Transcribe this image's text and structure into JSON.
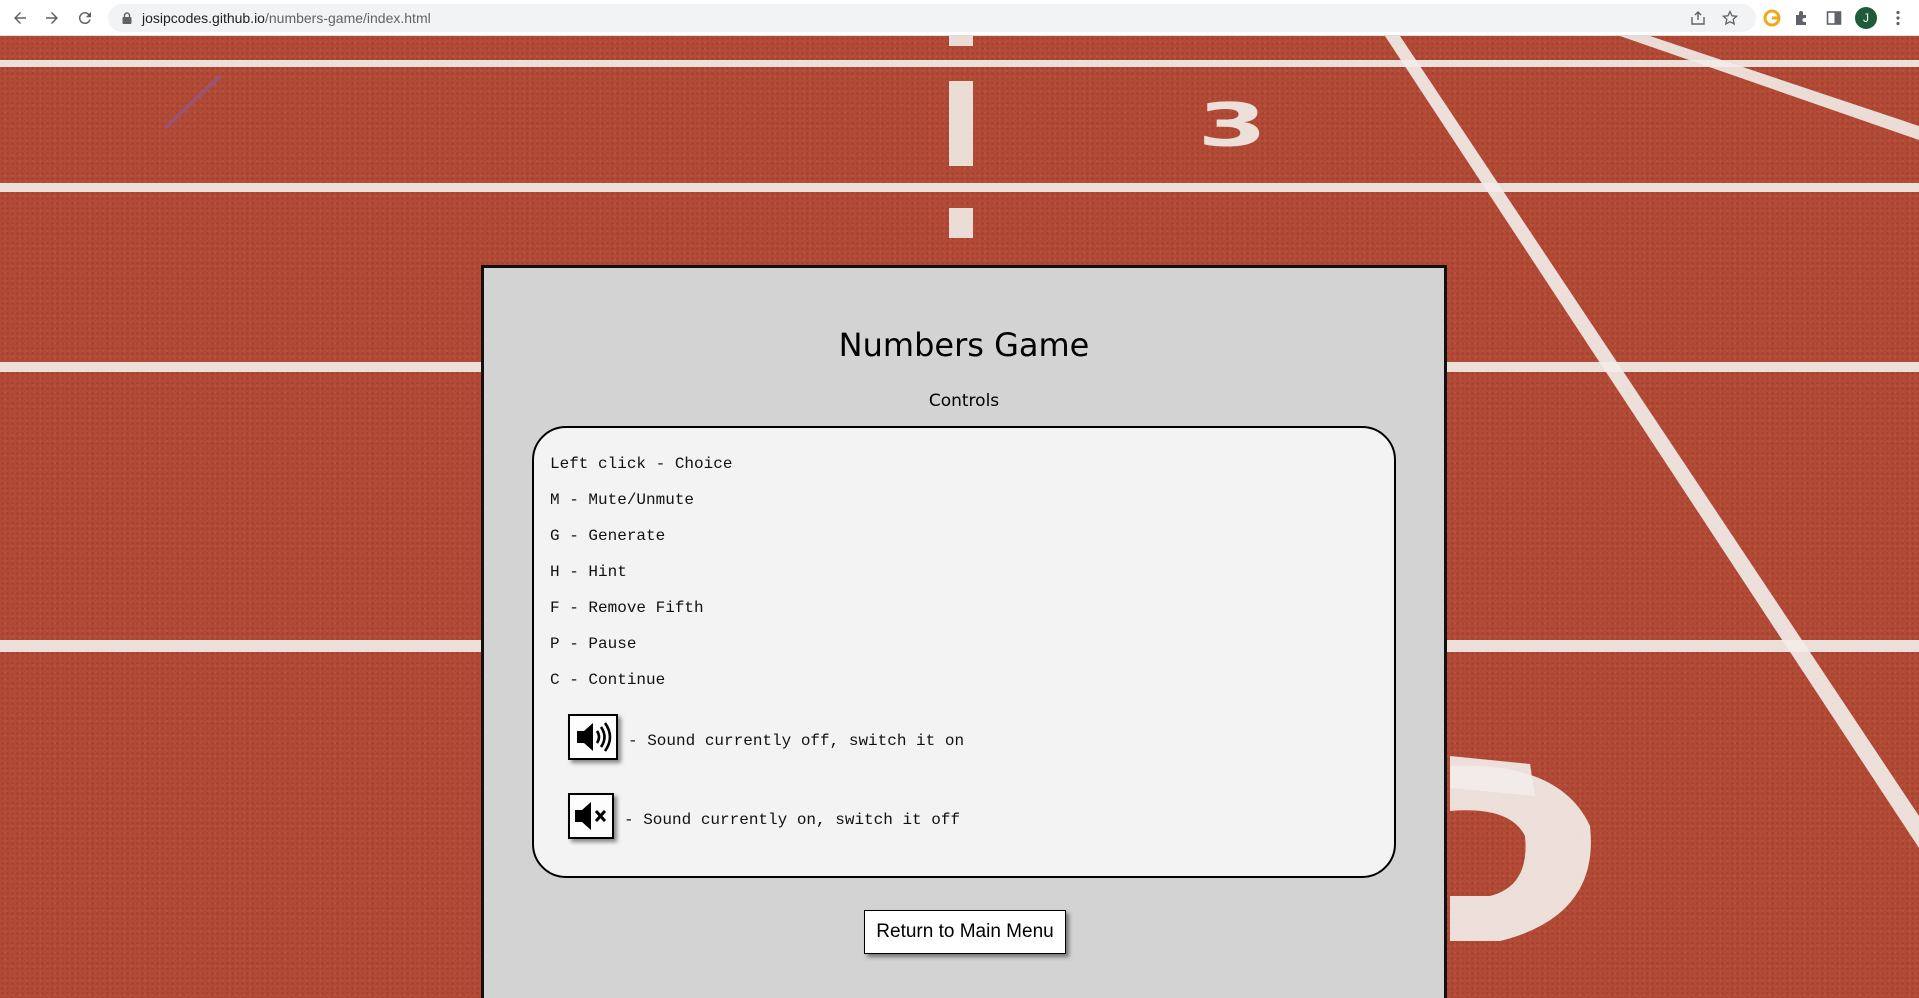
{
  "browser": {
    "url_host": "josipcodes.github.io",
    "url_path": "/numbers-game/index.html",
    "avatar_letter": "J"
  },
  "panel": {
    "title": "Numbers Game",
    "subtitle": "Controls",
    "controls": [
      "Left click - Choice",
      "M - Mute/Unmute",
      "G - Generate",
      "H - Hint",
      "F - Remove Fifth",
      "P - Pause",
      "C - Continue"
    ],
    "sound_on_icon": "speaker-on-icon",
    "sound_on_desc": "- Sound currently off, switch it on",
    "sound_off_icon": "speaker-muted-icon",
    "sound_off_desc": "- Sound currently on, switch it off",
    "menu_button": "Return to Main Menu"
  },
  "colors": {
    "track": "#b34a35",
    "panel": "#d3d3d3",
    "controls_box": "#f3f3f3"
  }
}
